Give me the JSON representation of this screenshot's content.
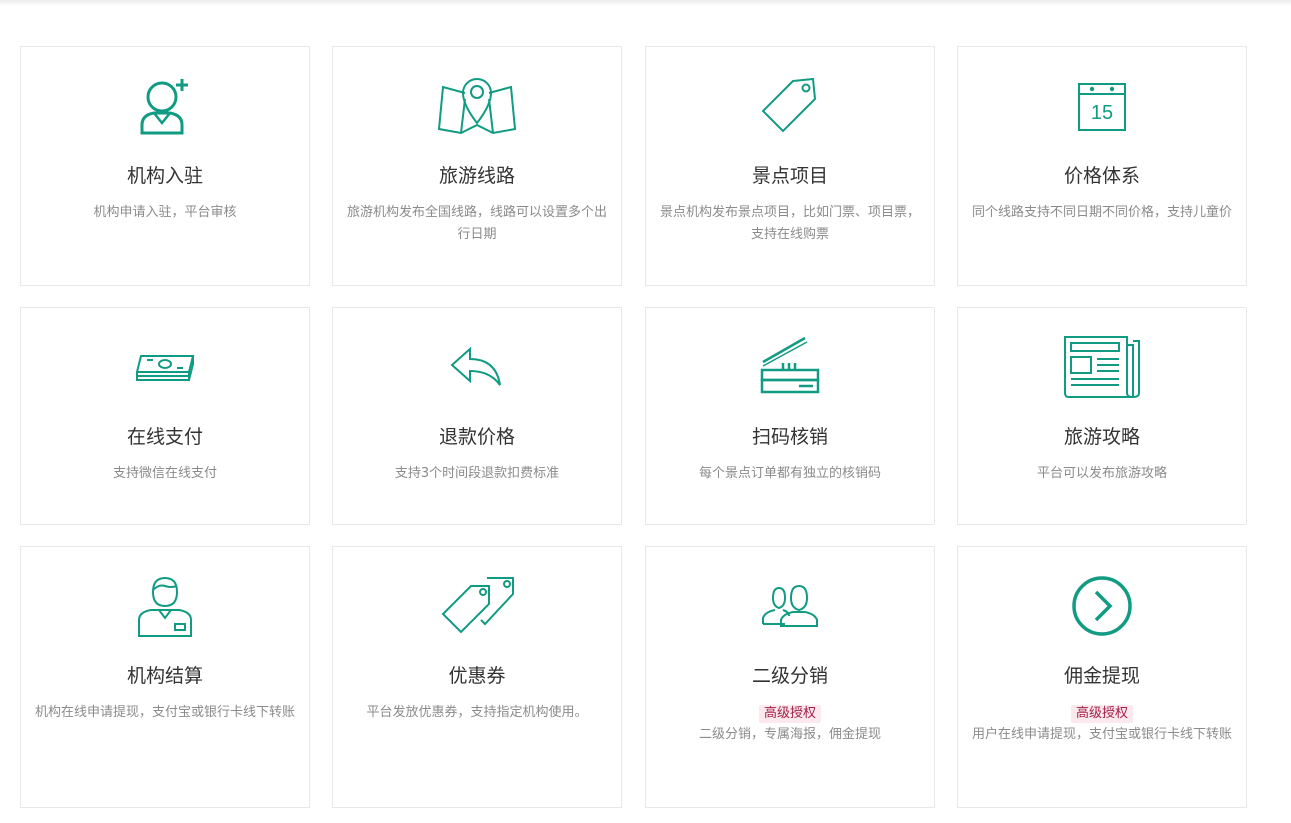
{
  "accent_color": "#119b82",
  "cards": [
    {
      "icon": "user-add-icon",
      "title": "机构入驻",
      "desc": "机构申请入驻，平台审核"
    },
    {
      "icon": "map-pin-icon",
      "title": "旅游线路",
      "desc": "旅游机构发布全国线路，线路可以设置多个出行日期"
    },
    {
      "icon": "tag-icon",
      "title": "景点项目",
      "desc": "景点机构发布景点项目，比如门票、项目票，支持在线购票"
    },
    {
      "icon": "calendar-icon",
      "title": "价格体系",
      "calendar_day": "15",
      "desc": "同个线路支持不同日期不同价格，支持儿童价"
    },
    {
      "icon": "cash-stack-icon",
      "title": "在线支付",
      "desc": "支持微信在线支付"
    },
    {
      "icon": "reply-arrow-icon",
      "title": "退款价格",
      "desc": "支持3个时间段退款扣费标准"
    },
    {
      "icon": "scanner-icon",
      "title": "扫码核销",
      "desc": "每个景点订单都有独立的核销码"
    },
    {
      "icon": "newspaper-icon",
      "title": "旅游攻略",
      "desc": "平台可以发布旅游攻略"
    },
    {
      "icon": "clerk-icon",
      "title": "机构结算",
      "desc": "机构在线申请提现，支付宝或银行卡线下转账"
    },
    {
      "icon": "double-tag-icon",
      "title": "优惠券",
      "desc": "平台发放优惠券，支持指定机构使用。"
    },
    {
      "icon": "users-icon",
      "title": "二级分销",
      "badge": "高级授权",
      "desc": "二级分销，专属海报，佣金提现"
    },
    {
      "icon": "circle-arrow-right-icon",
      "title": "佣金提现",
      "badge": "高级授权",
      "desc": "用户在线申请提现，支付宝或银行卡线下转账"
    }
  ]
}
